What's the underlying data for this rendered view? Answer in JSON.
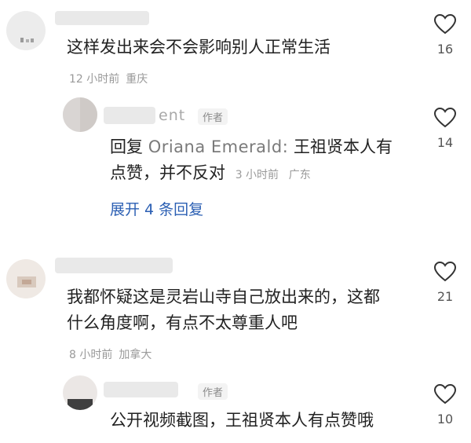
{
  "comments": [
    {
      "text": "这样发出来会不会影响别人正常生活",
      "time": "12 小时前",
      "location": "重庆",
      "likes": "16",
      "replies": [
        {
          "name_fragment": "ent",
          "badge": "作者",
          "reply_prefix": "回复",
          "reply_target": "Oriana Emerald:",
          "text_line1": "王祖贤本人有",
          "text_line2": "点赞，并不反对",
          "time": "3 小时前",
          "location": "广东",
          "likes": "14"
        }
      ],
      "expand_label": "展开 4 条回复"
    },
    {
      "text_line1": "我都怀疑这是灵岩山寺自己放出来的，这都",
      "text_line2": "什么角度啊，有点不太尊重人吧",
      "time": "8 小时前",
      "location": "加拿大",
      "likes": "21",
      "replies": [
        {
          "badge": "作者",
          "text": "公开视频截图，王祖贤本人有点赞哦",
          "likes": "10"
        }
      ]
    }
  ],
  "icons": {
    "like": "heart-outline-icon"
  }
}
